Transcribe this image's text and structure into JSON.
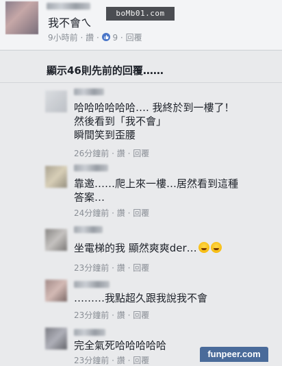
{
  "top_post": {
    "comment": "我不會ㄟ",
    "meta": {
      "time": "9小時前",
      "sep1": "·",
      "action": "讚",
      "sep2": "·",
      "likes": "9",
      "sep3": "·",
      "reply": "回覆"
    }
  },
  "watermark": {
    "text": "boMb01.com"
  },
  "show_previous": "顯示46則先前的回覆……",
  "replies": [
    {
      "lines": [
        "哈哈哈哈哈哈…. 我終於到一樓了！",
        "然後看到「我不會」",
        "瞬間笑到歪腰"
      ],
      "meta": {
        "time": "26分鐘前",
        "sep1": "·",
        "action": "讚",
        "sep2": "·",
        "reply": "回覆"
      }
    },
    {
      "lines": [
        "靠邀……爬上來一樓…居然看到這種",
        "答案…"
      ],
      "meta": {
        "time": "24分鐘前",
        "sep1": "·",
        "action": "讚",
        "sep2": "·",
        "reply": "回覆"
      }
    },
    {
      "lines": [
        "坐電梯的我  顯然爽爽der…"
      ],
      "emojis": [
        "laughing-emoji",
        "laughing-emoji"
      ],
      "meta": {
        "time": "23分鐘前",
        "sep1": "·",
        "action": "讚",
        "sep2": "·",
        "reply": "回覆"
      }
    },
    {
      "lines": [
        "………我點超久跟我說我不會"
      ],
      "meta": {
        "time": "23分鐘前",
        "sep1": "·",
        "action": "讚",
        "sep2": "·",
        "reply": "回覆"
      }
    },
    {
      "lines": [
        "完全氣死哈哈哈哈哈"
      ],
      "meta": {
        "time": "23分鐘前",
        "sep1": "·",
        "action": "讚",
        "sep2": "·",
        "reply": "回覆"
      }
    }
  ],
  "brand": {
    "text": "funpeer.com"
  },
  "colors": {
    "meta": "#8a8f96",
    "background": "#e9eaec",
    "brand": "#4a6b9a",
    "watermark": "#4b4d52"
  }
}
